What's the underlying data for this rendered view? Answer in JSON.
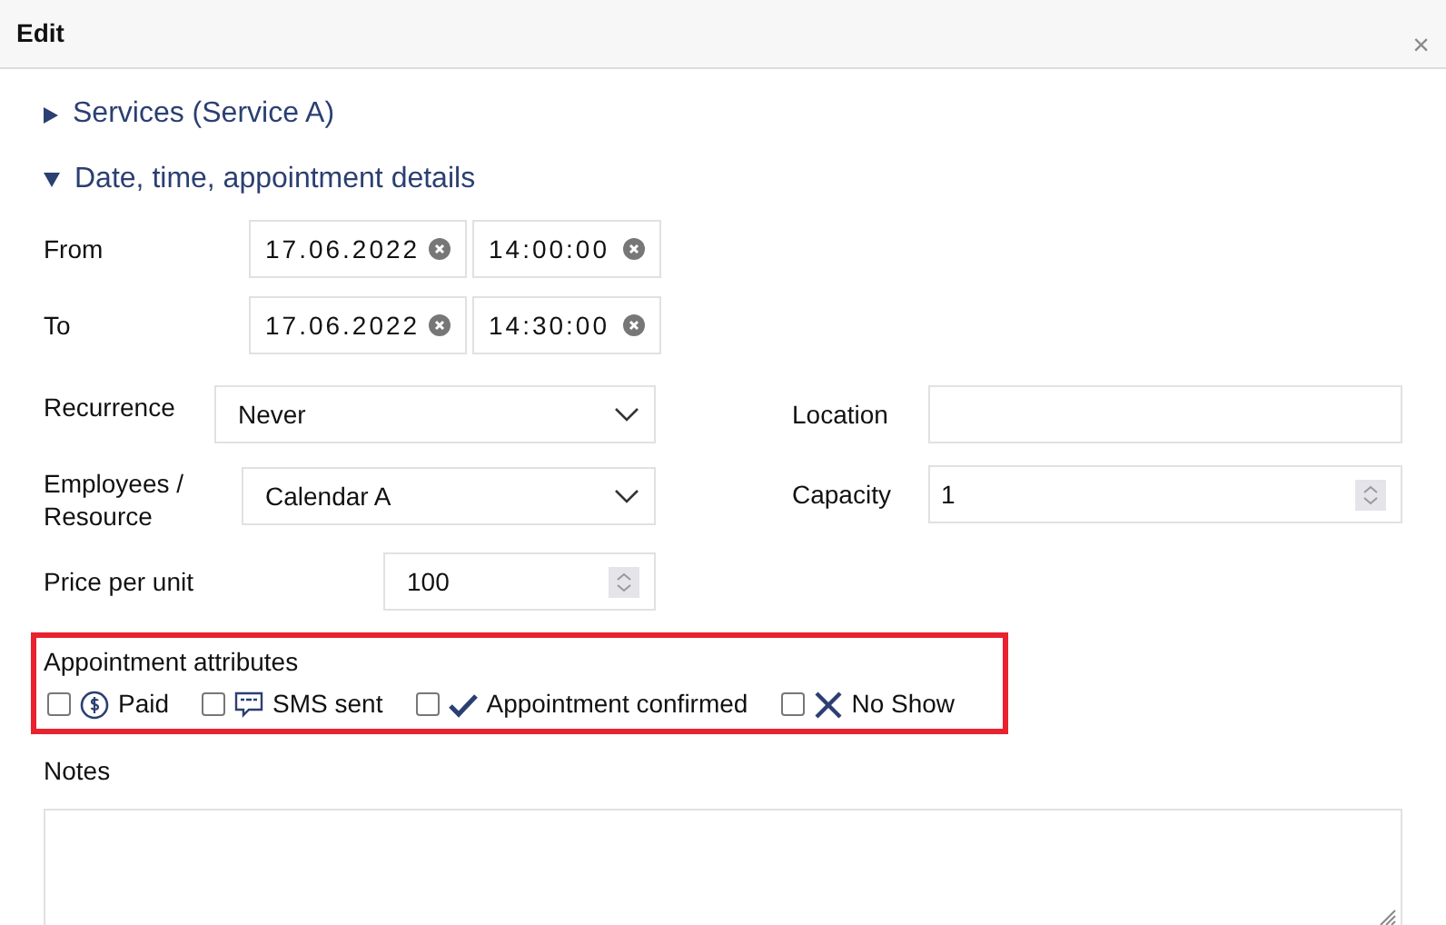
{
  "window": {
    "title": "Edit",
    "close": "×"
  },
  "sections": [
    {
      "title": "Services (Service A)",
      "expanded": false
    },
    {
      "title": "Date, time, appointment details",
      "expanded": true
    }
  ],
  "from": {
    "label": "From",
    "date": "17.06.2022",
    "time": "14:00:00"
  },
  "to": {
    "label": "To",
    "date": "17.06.2022",
    "time": "14:30:00"
  },
  "recurrence": {
    "label": "Recurrence",
    "value": "Never"
  },
  "location": {
    "label": "Location"
  },
  "employees": {
    "label": "Employees / Resource",
    "value": "Calendar A"
  },
  "capacity": {
    "label": "Capacity",
    "value": "1"
  },
  "price": {
    "label": "Price per unit",
    "value": "100"
  },
  "attributes": {
    "title": "Appointment attributes",
    "items": [
      {
        "label": "Paid",
        "kind": "paid",
        "checked": false
      },
      {
        "label": "SMS sent",
        "kind": "sms",
        "checked": false
      },
      {
        "label": "Appointment confirmed",
        "kind": "confirmed",
        "checked": false
      },
      {
        "label": "No Show",
        "kind": "noshow",
        "checked": false
      }
    ]
  },
  "notes": {
    "label": "Notes"
  }
}
